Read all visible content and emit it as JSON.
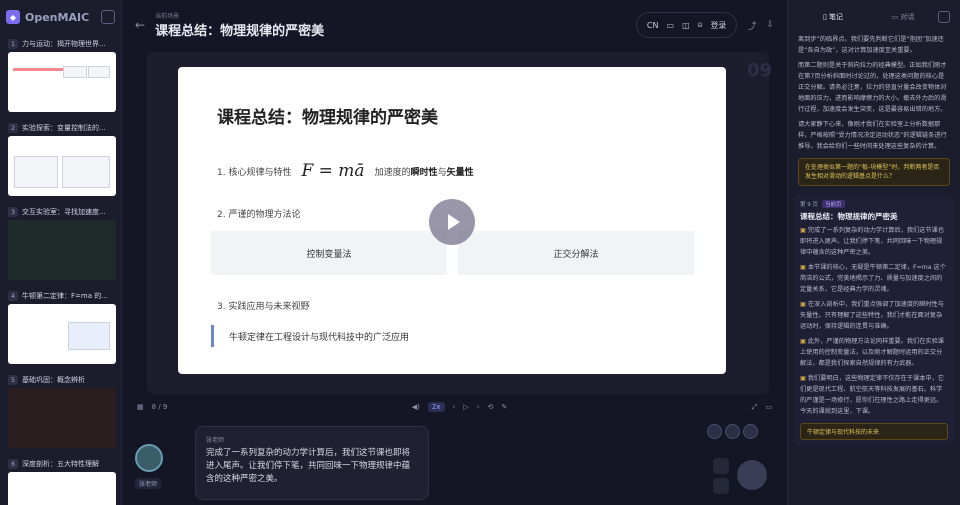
{
  "app": {
    "name": "OpenMAIC"
  },
  "sidebar": {
    "slides": [
      {
        "num": "1",
        "title": "力与运动：揭开物理世界..."
      },
      {
        "num": "2",
        "title": "实验探索：变量控制法的..."
      },
      {
        "num": "3",
        "title": "交互实验室：寻找加速度..."
      },
      {
        "num": "4",
        "title": "牛顿第二定律：F=ma 的..."
      },
      {
        "num": "5",
        "title": "基础巩固：概念辨析"
      },
      {
        "num": "6",
        "title": "深度剖析：五大特性理解"
      }
    ]
  },
  "header": {
    "breadcrumb": "当前场景",
    "title": "课程总结：物理规律的严密美",
    "lang": "CN",
    "login": "登录"
  },
  "slide": {
    "title": "课程总结：物理规律的严密美",
    "p1": "1. 核心规律与特性",
    "formula": "F = mā",
    "p1b": "加速度的",
    "p1c": "瞬时性",
    "p1d": "与",
    "p1e": "矢量性",
    "p2": "2. 严谨的物理方法论",
    "boxL": "控制变量法",
    "boxR": "正交分解法",
    "p3": "3. 实践应用与未来视野",
    "quote": "牛顿定律在工程设计与现代科技中的广泛应用",
    "page": "09"
  },
  "controls": {
    "index": "8 / 9",
    "speed": "2x"
  },
  "teacher": {
    "label": "张老师",
    "speaker": "张老师",
    "speech": "完成了一系列复杂的动力学计算后，我们这节课也即将进入尾声。让我们停下笔，共同回味一下物理规律中蕴含的这种严密之美。"
  },
  "right": {
    "tabs": {
      "notes": "笔记",
      "chat": "对话"
    },
    "notes": [
      "离到步”的临界点。我们要先判断它们是“抱团”加速还是“各自为政”，这对计算加速度至关重要。",
      "而第二题则是关于斜向拉力的经典模型。正如我们刚才在第7页分析斜面时讨论过的，处理这类问题的核心是正交分解。请务必注意，拉力的竖直分量会改变物体对地面的压力，进而影响摩擦力的大小。撤去外力后的滑行过程，加速度会发生突变，这是最容易出错的地方。",
      "请大家静下心来，像刚才我们在实验室上分析数据那样，严格按照“受力情况决定运动状态”的逻辑链条进行推导。我会给你们一些时间来处理这些复杂的计算。"
    ],
    "question": "在处理类似第一题的“板-块模型”时，判断两者是否发生相对滑动的逻辑基点是什么？",
    "section": {
      "page": "第 9 页",
      "tag": "当前页",
      "head": "课程总结：物理规律的严密美",
      "paras": [
        "完成了一系列复杂的动力学计算后，我们这节课也即将进入尾声。让我们停下笔，共同回味一下物理规律中蕴含的这种严密之美。",
        "本节课的核心，无疑是牛顿第二定律，F=ma 这个简洁的公式，完美地揭示了力、质量与加速度之间的定量关系，它是经典力学的灵魂。",
        "在深入剖析中，我们重点强调了加速度的瞬时性与矢量性。只有理解了这些特性，我们才能在面对复杂运动时，保持逻辑的连贯与准确。",
        "此外，严谨的物理方法论同样重要。我们在实验课上使用的控制变量法，以及刚才解题时运用的正交分解法，都是我们探索自然规律的有力武器。",
        "我们要明白，这些物理定律不仅存在于课本中，它们更是现代工程、航空航天等科技发展的基石。科学的严谨是一场修行，愿你们在理性之路上走得更远。今天的课就到这里，下课。"
      ],
      "tagline": "牛顿定律与现代科技的未来"
    }
  }
}
